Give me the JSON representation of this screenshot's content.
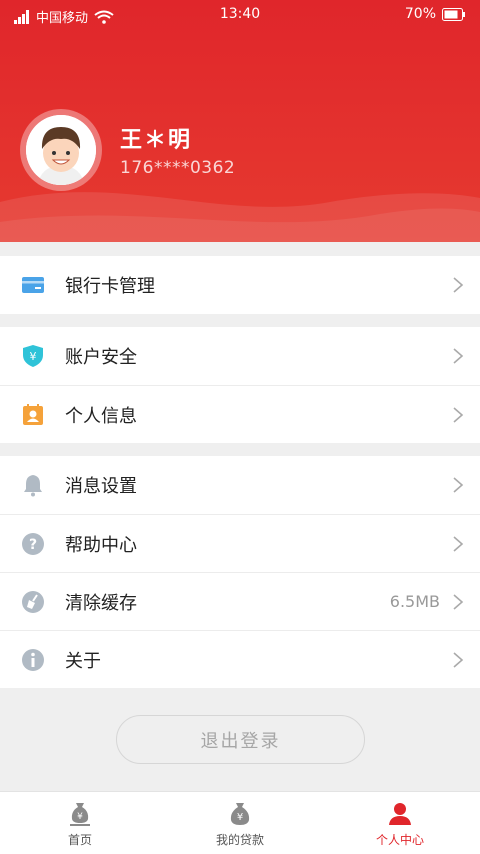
{
  "status_bar": {
    "carrier": "中国移动",
    "time": "13:40",
    "battery": "70%"
  },
  "profile": {
    "name": "王＊明",
    "phone": "176****0362"
  },
  "menu": {
    "bank_card": "银行卡管理",
    "account_security": "账户安全",
    "personal_info": "个人信息",
    "message_settings": "消息设置",
    "help_center": "帮助中心",
    "clear_cache": "清除缓存",
    "cache_size": "6.5MB",
    "about": "关于"
  },
  "logout_label": "退出登录",
  "tabs": {
    "home": "首页",
    "my_loans": "我的贷款",
    "personal_center": "个人中心"
  },
  "colors": {
    "brand_red": "#e0262b",
    "icon_blue": "#4aa3e8",
    "icon_cyan": "#2fc3d8",
    "icon_orange": "#f5a23a",
    "icon_gray": "#b0bac4"
  }
}
